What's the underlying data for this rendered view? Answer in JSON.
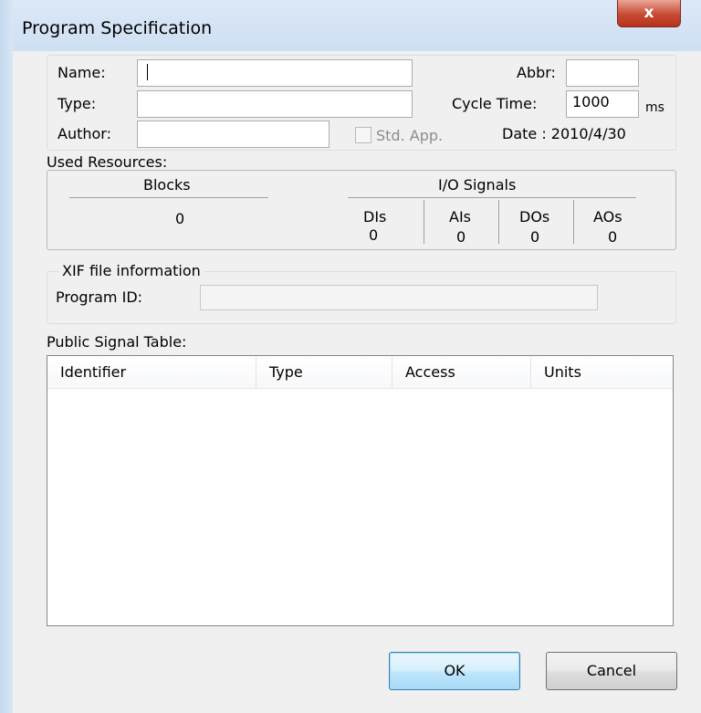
{
  "window": {
    "title": "Program Specification",
    "close_glyph": "x"
  },
  "fields": {
    "name_label": "Name:",
    "name_value": "",
    "type_label": "Type:",
    "type_value": "",
    "author_label": "Author:",
    "author_value": "",
    "abbr_label": "Abbr:",
    "abbr_value": "",
    "cycle_time_label": "Cycle Time:",
    "cycle_time_value": "1000",
    "cycle_time_unit": "ms",
    "std_app_label": "Std. App.",
    "std_app_checked": false,
    "date_label": "Date : 2010/4/30"
  },
  "used_resources": {
    "title": "Used Resources:",
    "blocks_label": "Blocks",
    "blocks_value": "0",
    "io_title": "I/O Signals",
    "signals": [
      {
        "label": "DIs",
        "value": "0"
      },
      {
        "label": "AIs",
        "value": "0"
      },
      {
        "label": "DOs",
        "value": "0"
      },
      {
        "label": "AOs",
        "value": "0"
      }
    ]
  },
  "xif": {
    "title": "XIF file information",
    "program_id_label": "Program ID:",
    "program_id_value": ""
  },
  "public_signal_table": {
    "title": "Public Signal Table:",
    "columns": [
      "Identifier",
      "Type",
      "Access",
      "Units"
    ],
    "rows": []
  },
  "buttons": {
    "ok": "OK",
    "cancel": "Cancel"
  },
  "colors": {
    "close_button": "#c84a33",
    "ok_border": "#3c7fb1",
    "frame": "#cfe0f3"
  }
}
